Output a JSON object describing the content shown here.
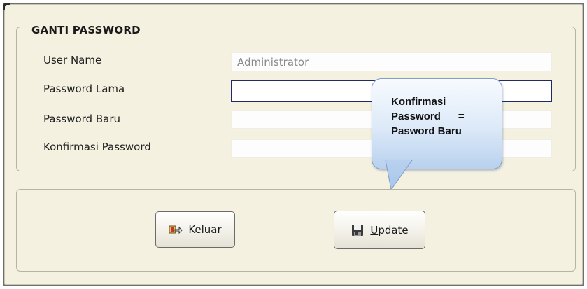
{
  "group": {
    "title": "GANTI PASSWORD"
  },
  "fields": [
    {
      "label": "User Name",
      "value": "Administrator"
    },
    {
      "label": "Password Lama",
      "value": ""
    },
    {
      "label": "Password Baru",
      "value": ""
    },
    {
      "label": "Konfirmasi Password",
      "value": ""
    }
  ],
  "callout": {
    "lines": [
      "Konfirmasi",
      "Password      =",
      "Pasword Baru"
    ]
  },
  "buttons": {
    "keluar": {
      "mnemonic": "K",
      "rest": "eluar",
      "icon": "exit-icon"
    },
    "update": {
      "mnemonic": "U",
      "rest": "pdate",
      "icon": "floppy-disk-icon"
    }
  },
  "colors": {
    "window_bg": "#f4f1e1",
    "active_border": "#1f2a66",
    "callout_fill": "#cfe0f4"
  }
}
